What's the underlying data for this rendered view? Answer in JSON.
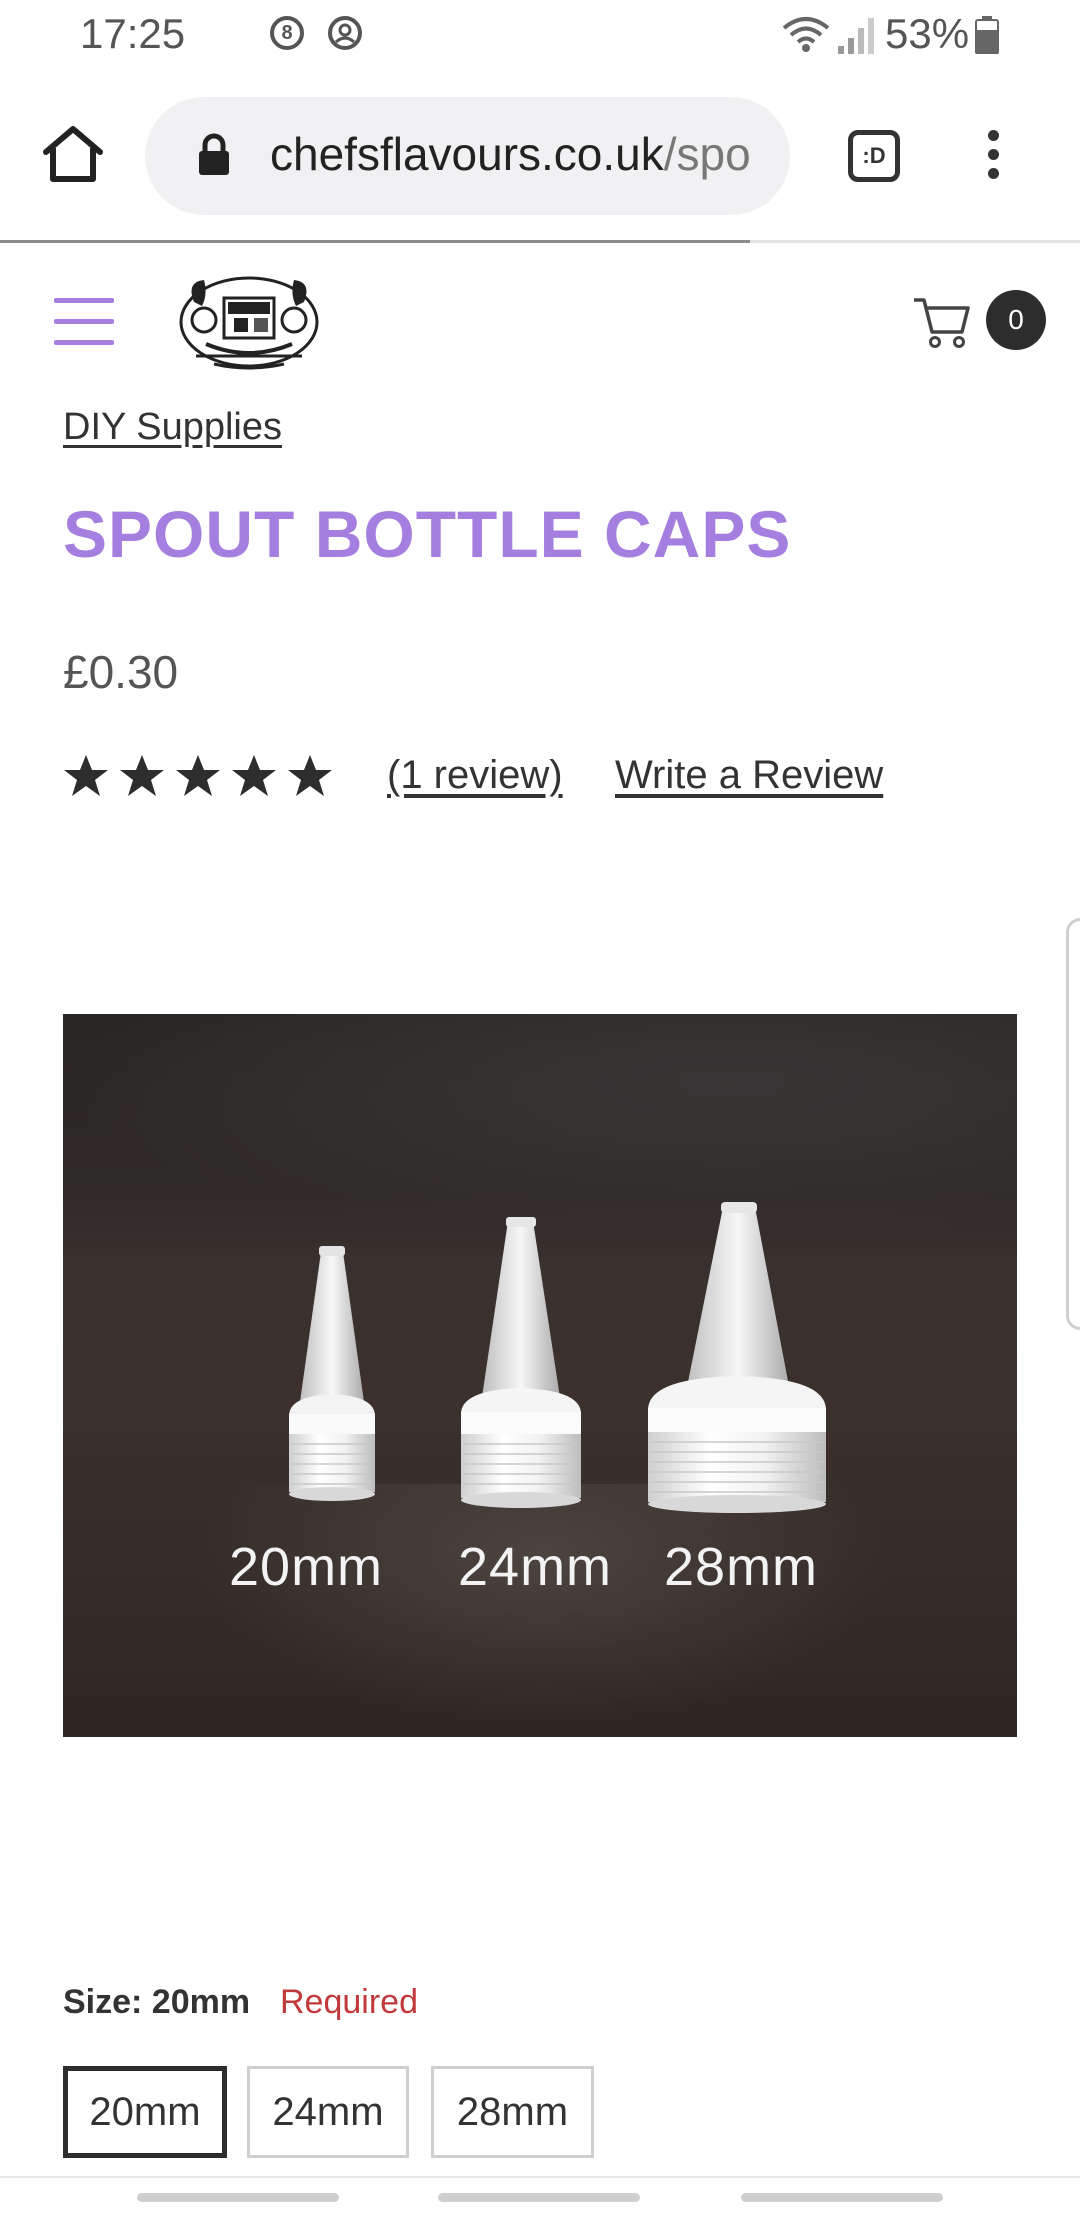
{
  "status_bar": {
    "time": "17:25",
    "notification_icon_1": "8",
    "notification_icon_2": "account-circle-icon",
    "battery_percent": "53%"
  },
  "browser": {
    "url_domain": "chefsflavours.co.uk",
    "url_path": "/spo",
    "tabs_label": ":D"
  },
  "header": {
    "cart_count": "0"
  },
  "product": {
    "breadcrumb": "DIY Supplies",
    "title": "SPOUT BOTTLE CAPS",
    "price": "£0.30",
    "rating_stars": 5,
    "review_count_link": "(1 review)",
    "write_review_link": "Write a Review",
    "photo_captions": [
      "20mm",
      "24mm",
      "28mm"
    ]
  },
  "size_selector": {
    "label": "Size: 20mm",
    "required_text": "Required",
    "options": [
      "20mm",
      "24mm",
      "28mm"
    ],
    "selected": "20mm"
  },
  "colors": {
    "accent": "#a57fe0",
    "required": "#c0393b",
    "text": "#333333"
  }
}
